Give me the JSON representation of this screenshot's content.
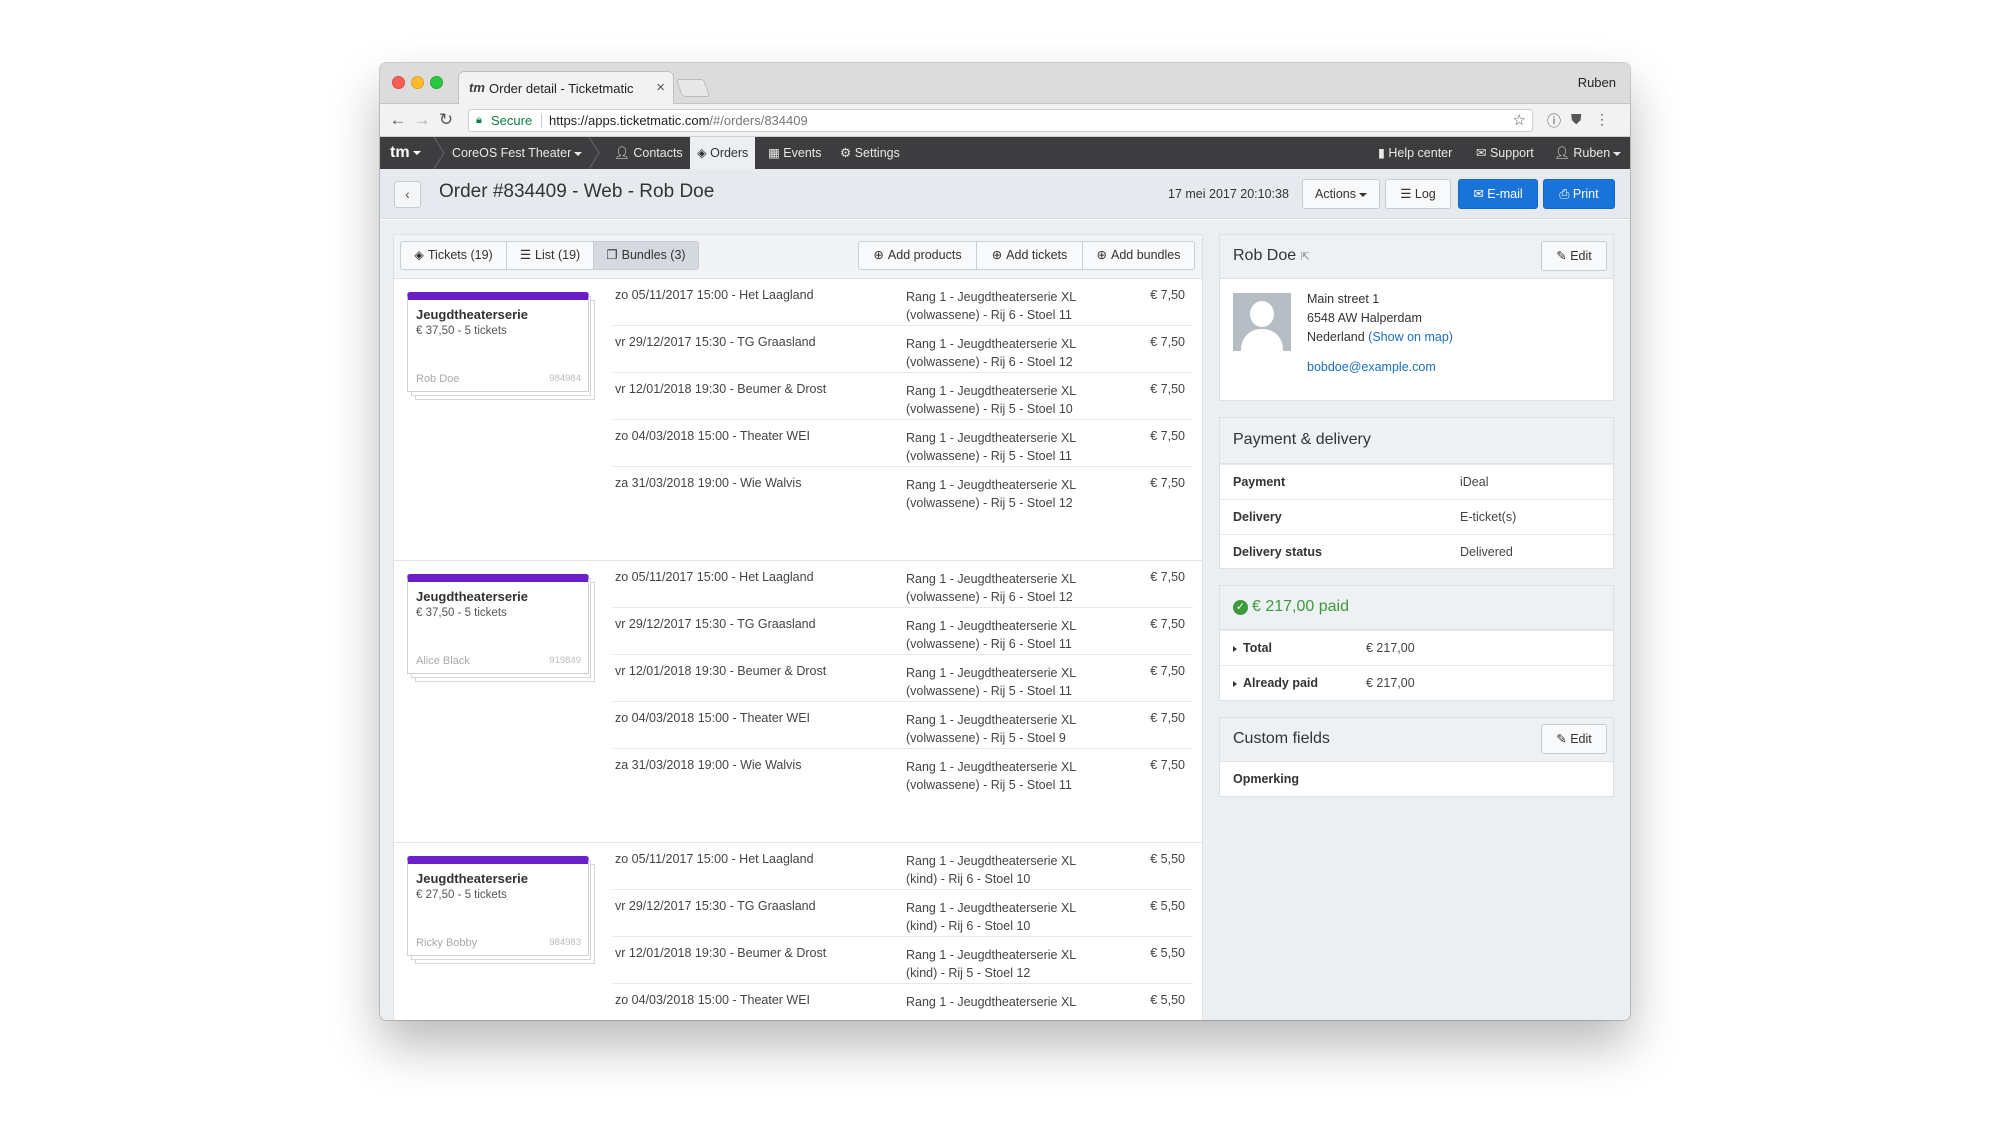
{
  "browser": {
    "tab_title": "Order detail - Ticketmatic",
    "favicon": "tm",
    "profile": "Ruben",
    "secure_label": "Secure",
    "url_host": "https://apps.ticketmatic.com",
    "url_path": "/#/orders/834409"
  },
  "nav": {
    "brand": "tm",
    "account": "CoreOS Fest Theater",
    "items": [
      "Contacts",
      "Orders",
      "Events",
      "Settings"
    ],
    "active": "Orders",
    "help": "Help center",
    "support": "Support",
    "user": "Ruben"
  },
  "order": {
    "title": "Order #834409 - Web - Rob Doe",
    "date": "17 mei 2017 20:10:38",
    "actions_label": "Actions",
    "log_label": "Log",
    "email_label": "E-mail",
    "print_label": "Print"
  },
  "toolbar": {
    "tickets_tab": "Tickets (19)",
    "list_tab": "List (19)",
    "bundles_tab": "Bundles (3)",
    "add_products": "Add products",
    "add_tickets": "Add tickets",
    "add_bundles": "Add bundles"
  },
  "bundles": [
    {
      "name": "Jeugdtheaterserie",
      "price": "€ 37,50 - 5 tickets",
      "holder": "Rob Doe",
      "id": "984984",
      "tickets": [
        {
          "event": "zo 05/11/2017 15:00 - Het Laagland",
          "seat1": "Rang 1 - Jeugdtheaterserie XL",
          "seat2": "(volwassene) - Rij 6 - Stoel 11",
          "price": "€ 7,50"
        },
        {
          "event": "vr 29/12/2017 15:30 - TG Graasland",
          "seat1": "Rang 1 - Jeugdtheaterserie XL",
          "seat2": "(volwassene) - Rij 6 - Stoel 12",
          "price": "€ 7,50"
        },
        {
          "event": "vr 12/01/2018 19:30 - Beumer & Drost",
          "seat1": "Rang 1 - Jeugdtheaterserie XL",
          "seat2": "(volwassene) - Rij 5 - Stoel 10",
          "price": "€ 7,50"
        },
        {
          "event": "zo 04/03/2018 15:00 - Theater WEI",
          "seat1": "Rang 1 - Jeugdtheaterserie XL",
          "seat2": "(volwassene) - Rij 5 - Stoel 11",
          "price": "€ 7,50"
        },
        {
          "event": "za 31/03/2018 19:00 - Wie Walvis",
          "seat1": "Rang 1 - Jeugdtheaterserie XL",
          "seat2": "(volwassene) - Rij 5 - Stoel 12",
          "price": "€ 7,50"
        }
      ]
    },
    {
      "name": "Jeugdtheaterserie",
      "price": "€ 37,50 - 5 tickets",
      "holder": "Alice Black",
      "id": "919849",
      "tickets": [
        {
          "event": "zo 05/11/2017 15:00 - Het Laagland",
          "seat1": "Rang 1 - Jeugdtheaterserie XL",
          "seat2": "(volwassene) - Rij 6 - Stoel 12",
          "price": "€ 7,50"
        },
        {
          "event": "vr 29/12/2017 15:30 - TG Graasland",
          "seat1": "Rang 1 - Jeugdtheaterserie XL",
          "seat2": "(volwassene) - Rij 6 - Stoel 11",
          "price": "€ 7,50"
        },
        {
          "event": "vr 12/01/2018 19:30 - Beumer & Drost",
          "seat1": "Rang 1 - Jeugdtheaterserie XL",
          "seat2": "(volwassene) - Rij 5 - Stoel 11",
          "price": "€ 7,50"
        },
        {
          "event": "zo 04/03/2018 15:00 - Theater WEI",
          "seat1": "Rang 1 - Jeugdtheaterserie XL",
          "seat2": "(volwassene) - Rij 5 - Stoel 9",
          "price": "€ 7,50"
        },
        {
          "event": "za 31/03/2018 19:00 - Wie Walvis",
          "seat1": "Rang 1 - Jeugdtheaterserie XL",
          "seat2": "(volwassene) - Rij 5 - Stoel 11",
          "price": "€ 7,50"
        }
      ]
    },
    {
      "name": "Jeugdtheaterserie",
      "price": "€ 27,50 - 5 tickets",
      "holder": "Ricky Bobby",
      "id": "984983",
      "tickets": [
        {
          "event": "zo 05/11/2017 15:00 - Het Laagland",
          "seat1": "Rang 1 - Jeugdtheaterserie XL",
          "seat2": "(kind) - Rij 6 - Stoel 10",
          "price": "€ 5,50"
        },
        {
          "event": "vr 29/12/2017 15:30 - TG Graasland",
          "seat1": "Rang 1 - Jeugdtheaterserie XL",
          "seat2": "(kind) - Rij 6 - Stoel 10",
          "price": "€ 5,50"
        },
        {
          "event": "vr 12/01/2018 19:30 - Beumer & Drost",
          "seat1": "Rang 1 - Jeugdtheaterserie XL",
          "seat2": "(kind) - Rij 5 - Stoel 12",
          "price": "€ 5,50"
        },
        {
          "event": "zo 04/03/2018 15:00 - Theater WEI",
          "seat1": "Rang 1 - Jeugdtheaterserie XL",
          "seat2": "",
          "price": "€ 5,50"
        }
      ]
    }
  ],
  "contact": {
    "name": "Rob Doe",
    "edit_label": "Edit",
    "street": "Main street 1",
    "city": "6548 AW Halperdam",
    "country": "Nederland",
    "map_link": "(Show on map)",
    "email": "bobdoe@example.com"
  },
  "payment": {
    "title": "Payment & delivery",
    "rows": [
      {
        "label": "Payment",
        "value": "iDeal"
      },
      {
        "label": "Delivery",
        "value": "E-ticket(s)"
      },
      {
        "label": "Delivery status",
        "value": "Delivered"
      }
    ]
  },
  "paid": {
    "title": "€ 217,00 paid",
    "rows": [
      {
        "label": "Total",
        "value": "€ 217,00"
      },
      {
        "label": "Already paid",
        "value": "€ 217,00"
      }
    ],
    "color": "#3c9a3c"
  },
  "custom": {
    "title": "Custom fields",
    "edit_label": "Edit",
    "field": "Opmerking"
  },
  "colors": {
    "accent": "#1a73d9",
    "bundle_bar": "#6a1fc8",
    "nav_bg": "#3d3d3f"
  }
}
